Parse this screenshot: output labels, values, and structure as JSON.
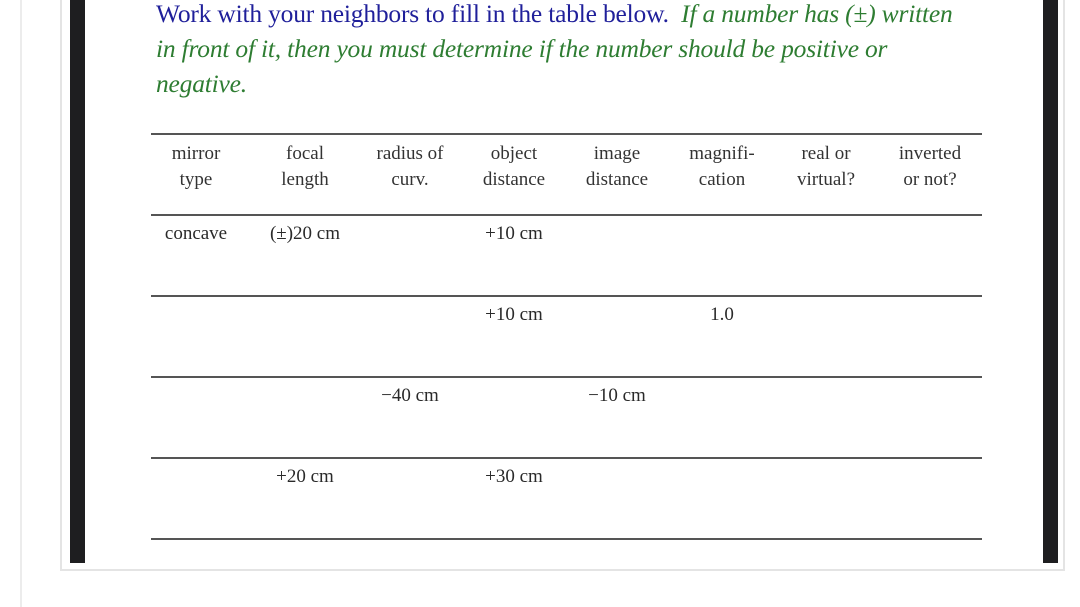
{
  "instructions": {
    "lead": "Work with your neighbors to fill in the table below.",
    "note": "If a number has (±) written in front of it, then you must determine if the number should be positive or negative."
  },
  "table": {
    "headers": [
      {
        "line1": "mirror",
        "line2": "type"
      },
      {
        "line1": "focal",
        "line2": "length"
      },
      {
        "line1": "radius of",
        "line2": "curv."
      },
      {
        "line1": "object",
        "line2": "distance"
      },
      {
        "line1": "image",
        "line2": "distance"
      },
      {
        "line1": "magnifi-",
        "line2": "cation"
      },
      {
        "line1": "real or",
        "line2": "virtual?"
      },
      {
        "line1": "inverted",
        "line2": "or not?"
      }
    ],
    "rows": [
      [
        "concave",
        "(±)20 cm",
        "",
        "+10 cm",
        "",
        "",
        "",
        ""
      ],
      [
        "",
        "",
        "",
        "+10 cm",
        "",
        "1.0",
        "",
        ""
      ],
      [
        "",
        "",
        "−40 cm",
        "",
        "−10 cm",
        "",
        "",
        ""
      ],
      [
        "",
        "+20 cm",
        "",
        "+30 cm",
        "",
        "",
        "",
        ""
      ]
    ]
  }
}
